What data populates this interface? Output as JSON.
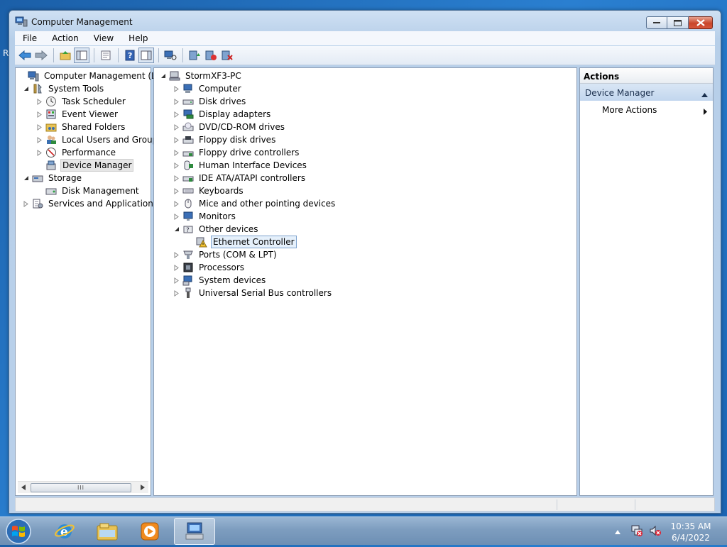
{
  "desktop": {
    "icon_label": "R"
  },
  "window": {
    "title": "Computer Management",
    "menu": [
      "File",
      "Action",
      "View",
      "Help"
    ]
  },
  "left_tree": [
    {
      "label": "Computer Management (Local",
      "icon": "computer-management-icon",
      "expand": "none"
    },
    {
      "label": "System Tools",
      "icon": "system-tools-icon",
      "expand": "open"
    },
    {
      "label": "Task Scheduler",
      "icon": "clock-icon",
      "expand": "closed"
    },
    {
      "label": "Event Viewer",
      "icon": "event-viewer-icon",
      "expand": "closed"
    },
    {
      "label": "Shared Folders",
      "icon": "shared-folder-icon",
      "expand": "closed"
    },
    {
      "label": "Local Users and Groups",
      "icon": "users-icon",
      "expand": "closed"
    },
    {
      "label": "Performance",
      "icon": "performance-icon",
      "expand": "closed"
    },
    {
      "label": "Device Manager",
      "icon": "device-manager-icon",
      "expand": "none",
      "selected": true
    },
    {
      "label": "Storage",
      "icon": "storage-icon",
      "expand": "open"
    },
    {
      "label": "Disk Management",
      "icon": "disk-management-icon",
      "expand": "none"
    },
    {
      "label": "Services and Applications",
      "icon": "services-icon",
      "expand": "closed"
    }
  ],
  "scrollbar": {
    "thumb_label": "III"
  },
  "device_tree": [
    {
      "label": "StormXF3-PC",
      "icon": "pc-icon",
      "expand": "open"
    },
    {
      "label": "Computer",
      "icon": "computer-icon",
      "expand": "closed"
    },
    {
      "label": "Disk drives",
      "icon": "disk-drive-icon",
      "expand": "closed"
    },
    {
      "label": "Display adapters",
      "icon": "display-adapter-icon",
      "expand": "closed"
    },
    {
      "label": "DVD/CD-ROM drives",
      "icon": "dvd-icon",
      "expand": "closed"
    },
    {
      "label": "Floppy disk drives",
      "icon": "floppy-icon",
      "expand": "closed"
    },
    {
      "label": "Floppy drive controllers",
      "icon": "floppy-controller-icon",
      "expand": "closed"
    },
    {
      "label": "Human Interface Devices",
      "icon": "hid-icon",
      "expand": "closed"
    },
    {
      "label": "IDE ATA/ATAPI controllers",
      "icon": "ide-icon",
      "expand": "closed"
    },
    {
      "label": "Keyboards",
      "icon": "keyboard-icon",
      "expand": "closed"
    },
    {
      "label": "Mice and other pointing devices",
      "icon": "mouse-icon",
      "expand": "closed"
    },
    {
      "label": "Monitors",
      "icon": "monitor-icon",
      "expand": "closed"
    },
    {
      "label": "Other devices",
      "icon": "other-devices-icon",
      "expand": "open"
    },
    {
      "label": "Ethernet Controller",
      "icon": "warning-device-icon",
      "expand": "none",
      "selected": true,
      "child": true
    },
    {
      "label": "Ports (COM & LPT)",
      "icon": "ports-icon",
      "expand": "closed"
    },
    {
      "label": "Processors",
      "icon": "processor-icon",
      "expand": "closed"
    },
    {
      "label": "System devices",
      "icon": "system-devices-icon",
      "expand": "closed"
    },
    {
      "label": "Universal Serial Bus controllers",
      "icon": "usb-icon",
      "expand": "closed"
    }
  ],
  "actions": {
    "header": "Actions",
    "section": "Device Manager",
    "more": "More Actions"
  },
  "taskbar": {
    "time": "10:35 AM",
    "date": "6/4/2022"
  }
}
